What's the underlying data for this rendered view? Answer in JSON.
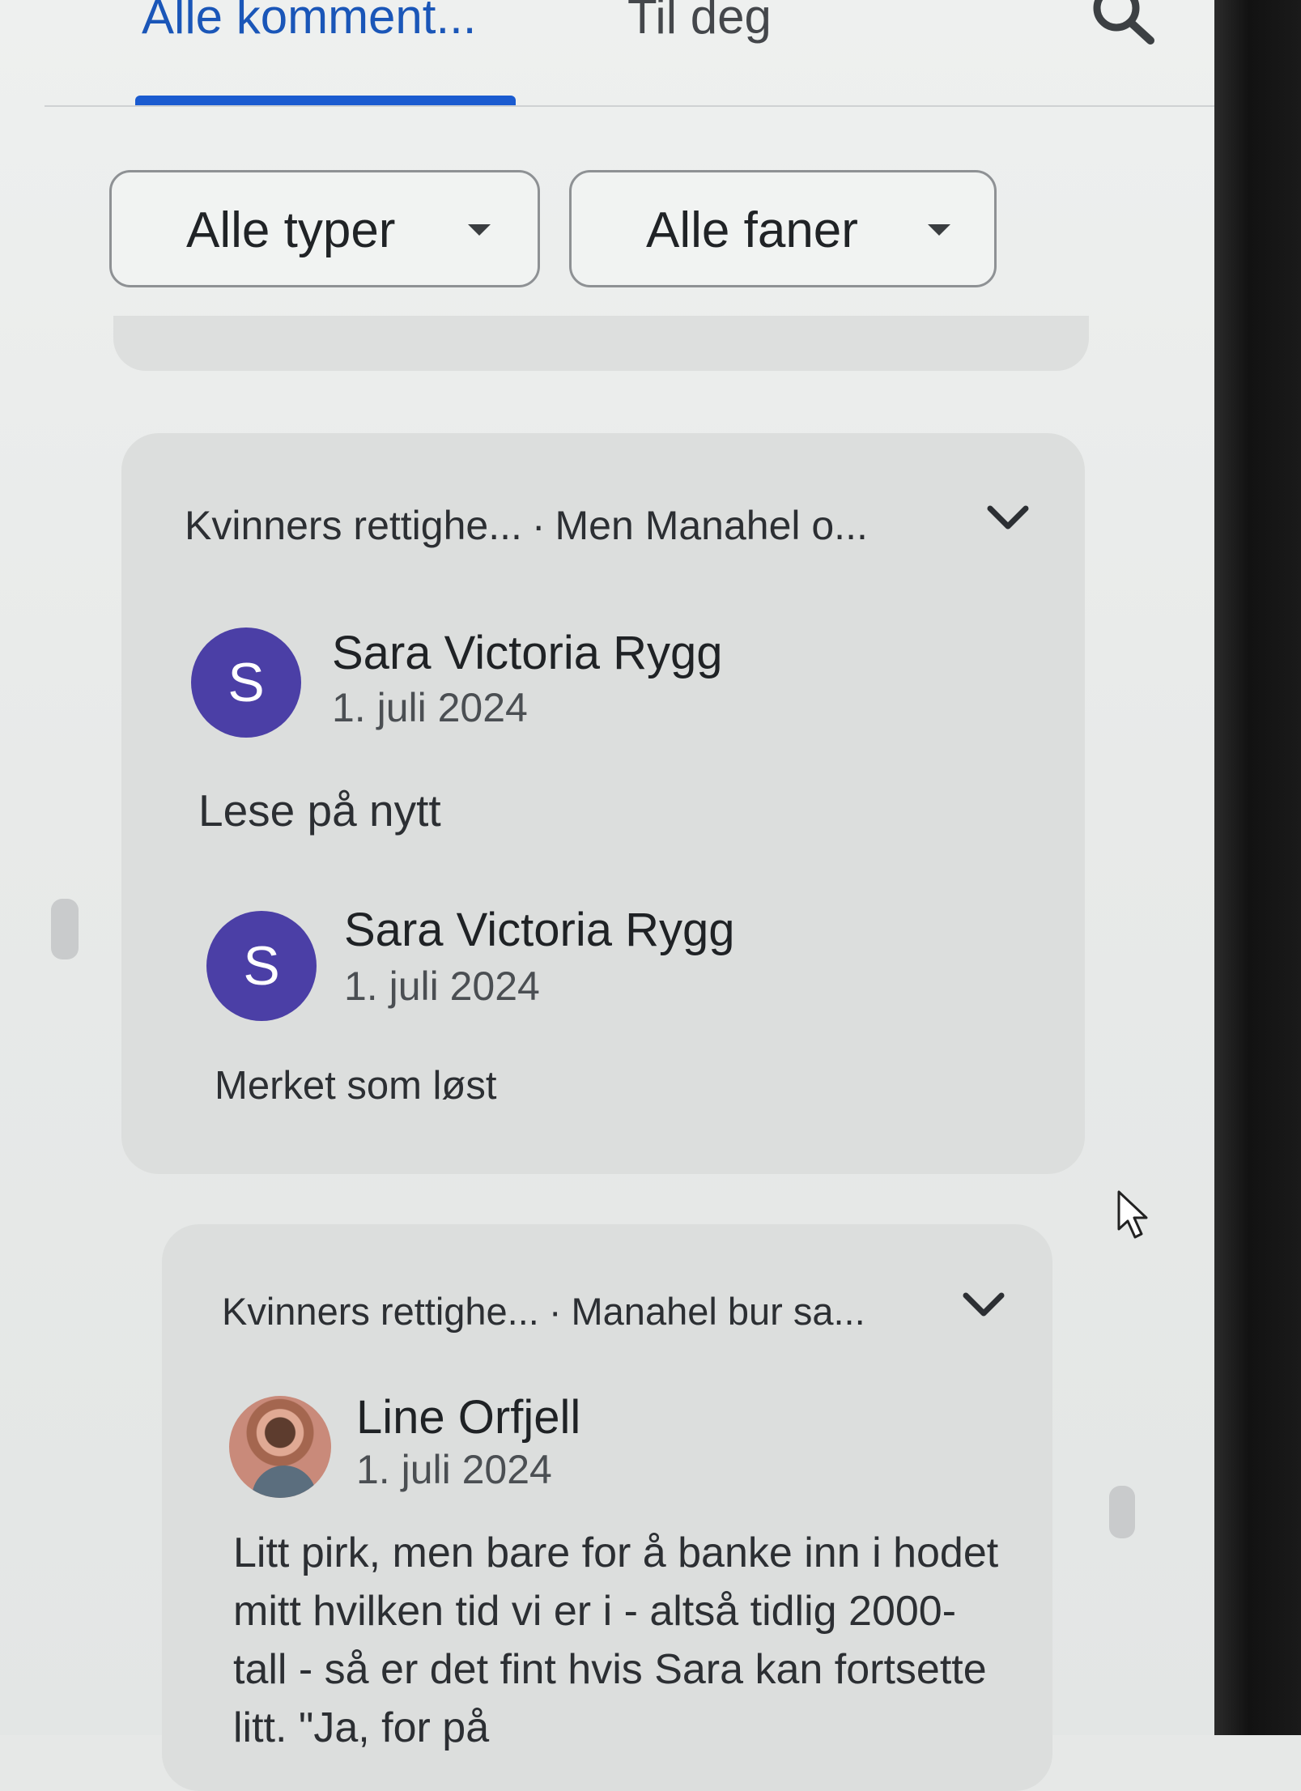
{
  "tabs": {
    "items": [
      {
        "label": "Alle komment..."
      },
      {
        "label": "Til deg"
      }
    ]
  },
  "filters": {
    "type_label": "Alle typer",
    "tab_label": "Alle faner"
  },
  "threads": [
    {
      "tab_name": "Kvinners rettighe...",
      "quote": "Men Manahel o...",
      "comments": [
        {
          "initial": "S",
          "author": "Sara Victoria Rygg",
          "date": "1. juli 2024",
          "text": "Lese på nytt"
        },
        {
          "initial": "S",
          "author": "Sara Victoria Rygg",
          "date": "1. juli 2024",
          "text": "Merket som løst"
        }
      ]
    },
    {
      "tab_name": "Kvinners rettighe...",
      "quote": "Manahel bur sa...",
      "comments": [
        {
          "author": "Line Orfjell",
          "date": "1. juli 2024",
          "text": "Litt pirk, men bare for å banke inn i hodet mitt hvilken tid vi er i - altså tidlig 2000-tall - så er det fint hvis Sara kan fortsette litt. \"Ja, for på"
        }
      ]
    }
  ],
  "separator": "·",
  "colors": {
    "accent": "#1a5bd0",
    "avatar": "#4b3fa6",
    "card": "#dcdedd"
  }
}
